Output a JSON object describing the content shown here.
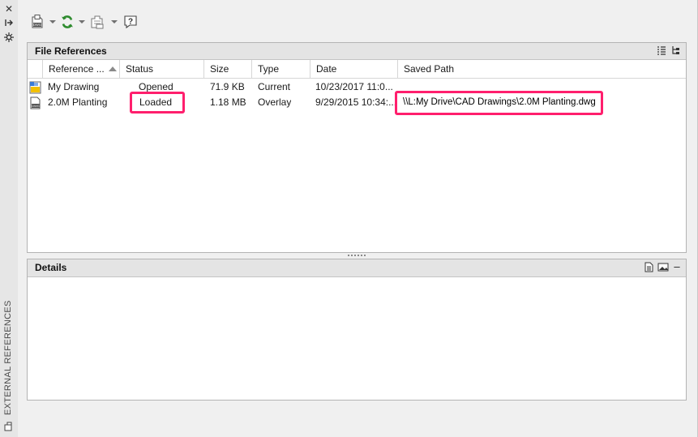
{
  "palette": {
    "highlight": "#ff1f6d",
    "header_bg": "#e4e4e4",
    "panel_bg": "#f0f0f0",
    "refresh_green": "#2e8b2e"
  },
  "side_panel": {
    "title": "EXTERNAL REFERENCES",
    "buttons": [
      "close-icon",
      "auto-hide-icon",
      "properties-icon"
    ]
  },
  "toolbar": {
    "attach_icon": "attach-dwg-icon",
    "refresh_icon": "refresh-icon",
    "change_path_icon": "change-path-icon",
    "help_icon": "help-icon"
  },
  "file_references": {
    "title": "File References",
    "view_icons": [
      "list-view-icon",
      "tree-view-icon"
    ],
    "columns": [
      "Reference ...",
      "Status",
      "Size",
      "Type",
      "Date",
      "Saved Path"
    ],
    "rows": [
      {
        "name": "My Drawing",
        "status": "Opened",
        "size": "71.9 KB",
        "type": "Current",
        "date": "10/23/2017 11:0...",
        "saved_path": "",
        "icon": "current-drawing-icon"
      },
      {
        "name": "2.0M Planting",
        "status": "Loaded",
        "size": "1.18 MB",
        "type": "Overlay",
        "date": "9/29/2015 10:34:...",
        "saved_path": "\\\\L:My Drive\\CAD Drawings\\2.0M Planting.dwg",
        "icon": "dwg-file-icon"
      }
    ]
  },
  "details": {
    "title": "Details",
    "view_icons": [
      "details-icon",
      "preview-icon"
    ],
    "collapse": "–"
  }
}
